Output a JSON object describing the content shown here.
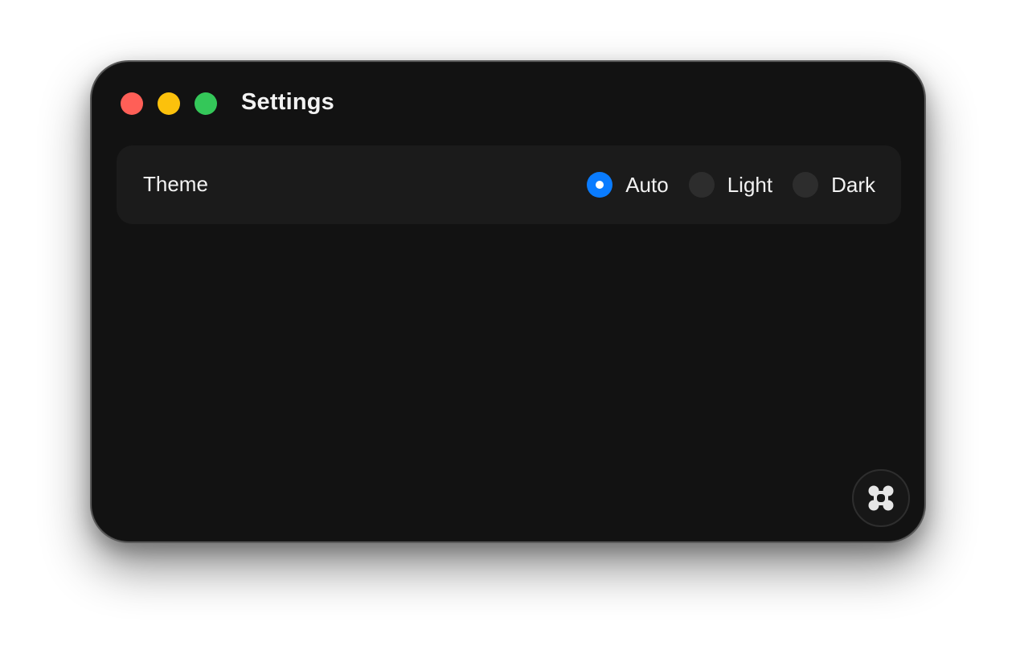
{
  "window": {
    "title": "Settings",
    "controls": {
      "close_color": "#ff5f57",
      "minimize_color": "#febc2e",
      "zoom_color": "#28c840"
    }
  },
  "theme_setting": {
    "label": "Theme",
    "selected": "Auto",
    "options": [
      {
        "label": "Auto",
        "selected": true
      },
      {
        "label": "Light",
        "selected": false
      },
      {
        "label": "Dark",
        "selected": false
      }
    ],
    "accent_color": "#0a7cff"
  },
  "fab": {
    "icon": "command-key-icon"
  }
}
